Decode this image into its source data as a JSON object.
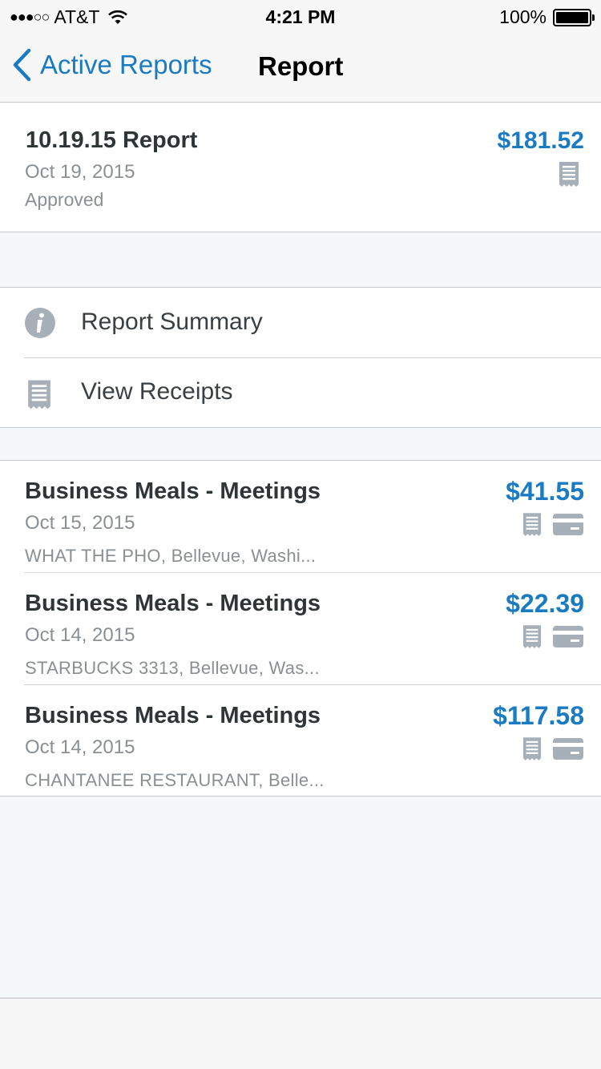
{
  "status_bar": {
    "signal_dots": "●●●○○",
    "carrier": "AT&T",
    "time": "4:21 PM",
    "battery": "100%"
  },
  "nav": {
    "back_label": "Active Reports",
    "title": "Report"
  },
  "report": {
    "name": "10.19.15 Report",
    "date": "Oct 19, 2015",
    "status": "Approved",
    "amount": "$181.52"
  },
  "menu": [
    {
      "label": "Report Summary",
      "icon": "info-icon"
    },
    {
      "label": "View Receipts",
      "icon": "receipt-icon"
    }
  ],
  "expenses": [
    {
      "type": "Business Meals - Meetings",
      "date": "Oct 15, 2015",
      "merchant": "WHAT THE PHO, Bellevue, Washi...",
      "amount": "$41.55"
    },
    {
      "type": "Business Meals - Meetings",
      "date": "Oct 14, 2015",
      "merchant": "STARBUCKS 3313, Bellevue, Was...",
      "amount": "$22.39"
    },
    {
      "type": "Business Meals - Meetings",
      "date": "Oct 14, 2015",
      "merchant": "CHANTANEE RESTAURANT, Belle...",
      "amount": "$117.58"
    }
  ],
  "colors": {
    "accent": "#1a7bc2",
    "icon_gray": "#a7b0b8",
    "text_dark": "#2f3437",
    "text_muted": "#8a8f94",
    "background": "#f5f8fb"
  }
}
